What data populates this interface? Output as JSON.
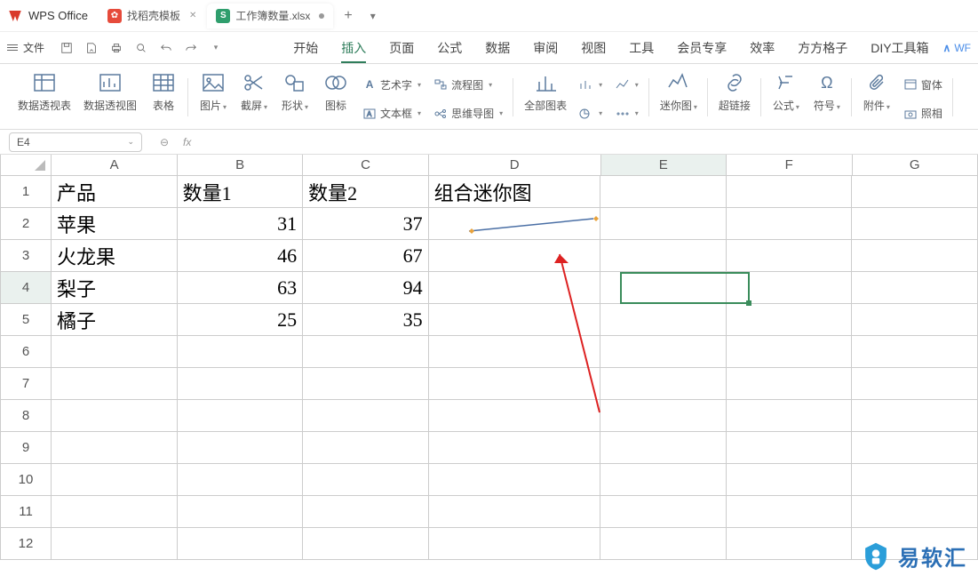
{
  "app": {
    "name": "WPS Office"
  },
  "tabs": [
    {
      "label": "找稻壳模板",
      "icon_color": "#e64b3b",
      "close": true
    },
    {
      "label": "工作簿数量.xlsx",
      "icon_letter": "S",
      "icon_bg": "#2f9e6d",
      "dirty": true
    }
  ],
  "menu_file_label": "文件",
  "menu_tabs": [
    "开始",
    "插入",
    "页面",
    "公式",
    "数据",
    "审阅",
    "视图",
    "工具",
    "会员专享",
    "效率",
    "方方格子",
    "DIY工具箱"
  ],
  "menu_active_index": 1,
  "menu_right": "WF",
  "ribbon": {
    "pivot_table": "数据透视表",
    "pivot_chart": "数据透视图",
    "table": "表格",
    "picture": "图片",
    "screenshot": "截屏",
    "shapes": "形状",
    "icons": "图标",
    "wordart": "艺术字",
    "textbox": "文本框",
    "flowchart": "流程图",
    "mindmap": "思维导图",
    "all_charts": "全部图表",
    "sparkline": "迷你图",
    "hyperlink": "超链接",
    "formula": "公式",
    "symbol": "符号",
    "attachment": "附件",
    "window": "窗体",
    "photo": "照相"
  },
  "namebox": {
    "cell": "E4"
  },
  "sheet": {
    "columns": [
      "A",
      "B",
      "C",
      "D",
      "E",
      "F",
      "G"
    ],
    "row_count": 12,
    "active_col": 4,
    "active_row": 4,
    "data": {
      "1": {
        "A": "产品",
        "B": "数量1",
        "C": "数量2",
        "D": "组合迷你图"
      },
      "2": {
        "A": "苹果",
        "B": "31",
        "C": "37"
      },
      "3": {
        "A": "火龙果",
        "B": "46",
        "C": "67"
      },
      "4": {
        "A": "梨子",
        "B": "63",
        "C": "94"
      },
      "5": {
        "A": "橘子",
        "B": "25",
        "C": "35"
      }
    }
  },
  "watermark": {
    "text": "易软汇"
  }
}
